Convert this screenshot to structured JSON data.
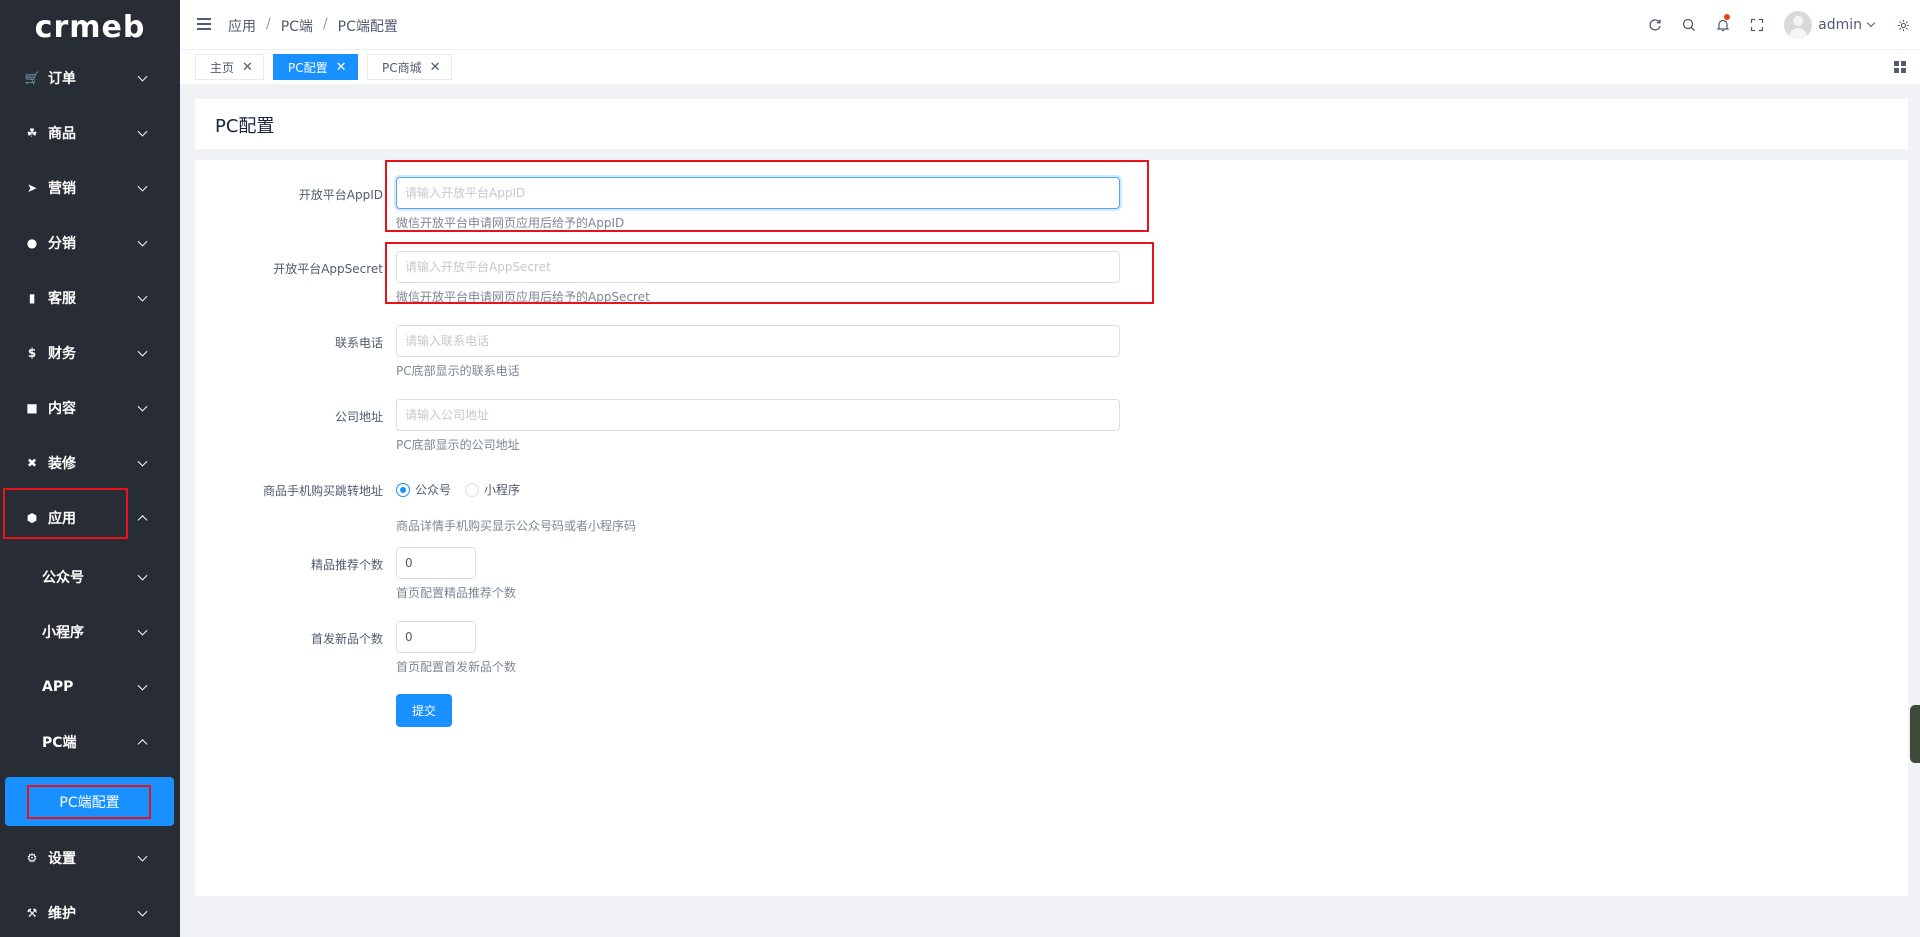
{
  "logo": "crmeb",
  "sidebar": {
    "menu": [
      {
        "label": "订单",
        "icon": "cart-icon"
      },
      {
        "label": "商品",
        "icon": "basket-icon"
      },
      {
        "label": "营销",
        "icon": "send-icon"
      },
      {
        "label": "分销",
        "icon": "users-icon"
      },
      {
        "label": "客服",
        "icon": "chat-icon"
      },
      {
        "label": "财务",
        "icon": "dollar-icon"
      },
      {
        "label": "内容",
        "icon": "book-icon"
      },
      {
        "label": "装修",
        "icon": "tools-icon"
      },
      {
        "label": "应用",
        "icon": "cube-icon"
      }
    ],
    "sub": [
      {
        "label": "公众号"
      },
      {
        "label": "小程序"
      },
      {
        "label": "APP"
      },
      {
        "label": "PC端"
      }
    ],
    "active_leaf": "PC端配置",
    "bottom": [
      {
        "label": "设置",
        "icon": "gear-icon"
      },
      {
        "label": "维护",
        "icon": "hammer-icon"
      }
    ]
  },
  "header": {
    "breadcrumb": [
      "应用",
      "PC端",
      "PC端配置"
    ],
    "breadcrumb_sep": "/",
    "username": "admin"
  },
  "tabs": [
    {
      "label": "主页",
      "active": false
    },
    {
      "label": "PC配置",
      "active": true
    },
    {
      "label": "PC商城",
      "active": false
    }
  ],
  "page": {
    "title": "PC配置"
  },
  "form": {
    "appid": {
      "label": "开放平台AppID",
      "value": "",
      "placeholder": "请输入开放平台AppID",
      "help": "微信开放平台申请网页应用后给予的AppID"
    },
    "appsecret": {
      "label": "开放平台AppSecret",
      "value": "",
      "placeholder": "请输入开放平台AppSecret",
      "help": "微信开放平台申请网页应用后给予的AppSecret"
    },
    "phone": {
      "label": "联系电话",
      "value": "",
      "placeholder": "请输入联系电话",
      "help": "PC底部显示的联系电话"
    },
    "address": {
      "label": "公司地址",
      "value": "",
      "placeholder": "请输入公司地址",
      "help": "PC底部显示的公司地址"
    },
    "jump": {
      "label": "商品手机购买跳转地址",
      "options": [
        "公众号",
        "小程序"
      ],
      "selected": "公众号",
      "help": "商品详情手机购买显示公众号码或者小程序码"
    },
    "recommend": {
      "label": "精品推荐个数",
      "value": "0",
      "help": "首页配置精品推荐个数"
    },
    "newcount": {
      "label": "首发新品个数",
      "value": "0",
      "help": "首页配置首发新品个数"
    },
    "submit": "提交"
  },
  "colors": {
    "sidebar_bg": "#282c34",
    "accent": "#1890ff",
    "highlight_box": "#e8121b"
  }
}
